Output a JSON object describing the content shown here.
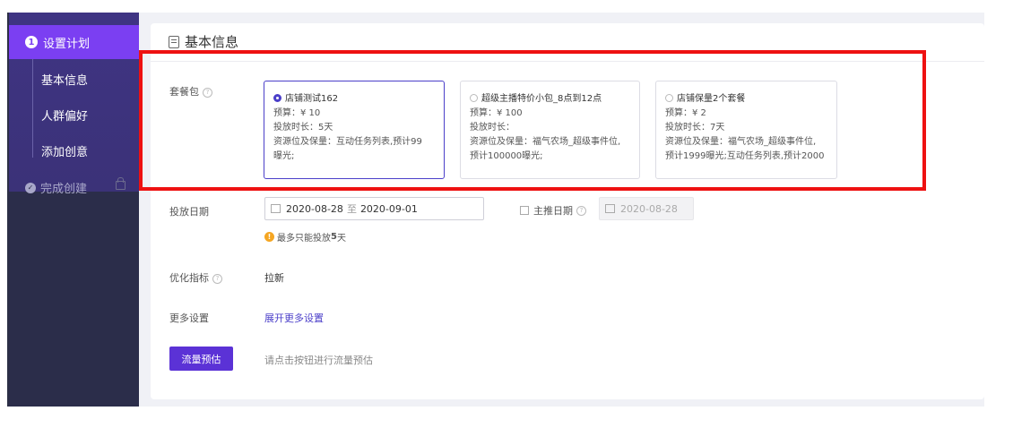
{
  "sidebar": {
    "active_step_number": "1",
    "active_step_label": "设置计划",
    "sub_items": [
      "基本信息",
      "人群偏好",
      "添加创意"
    ],
    "done_step_label": "完成创建"
  },
  "card": {
    "title": "基本信息"
  },
  "form": {
    "package_label": "套餐包",
    "packages": [
      {
        "name": "店铺测试162",
        "budget": "预算：¥ 10",
        "duration": "投放时长：5天",
        "resource_line1": "资源位及保量：互动任务列表,预计99",
        "resource_line2": "曝光;",
        "selected": true
      },
      {
        "name": "超级主播特价小包_8点到12点",
        "budget": "预算：¥ 100",
        "duration": "投放时长：",
        "resource_line1": "资源位及保量：福气农场_超级事件位,",
        "resource_line2": "预计100000曝光;",
        "selected": false
      },
      {
        "name": "店铺保量2个套餐",
        "budget": "预算：¥ 2",
        "duration": "投放时长：7天",
        "resource_line1": "资源位及保量：福气农场_超级事件位,",
        "resource_line2": "预计1999曝光;互动任务列表,预计2000",
        "selected": false
      }
    ],
    "date_label": "投放日期",
    "date_start": "2020-08-28",
    "date_sep": "至",
    "date_end": "2020-09-01",
    "main_date_label": "主推日期",
    "main_date_value": "2020-08-28",
    "warning_prefix": "最多只能投放",
    "warning_days": "5",
    "warning_suffix": "天",
    "metric_label": "优化指标",
    "metric_value": "拉新",
    "more_label": "更多设置",
    "more_link": "展开更多设置",
    "estimate_button": "流量预估",
    "estimate_hint": "请点击按钮进行流量预估"
  },
  "colors": {
    "accent": "#5b32d6",
    "sidebar_bg": "#2b2d4a",
    "active_nav": "#7b3ff2",
    "highlight_box": "#ee1111"
  }
}
